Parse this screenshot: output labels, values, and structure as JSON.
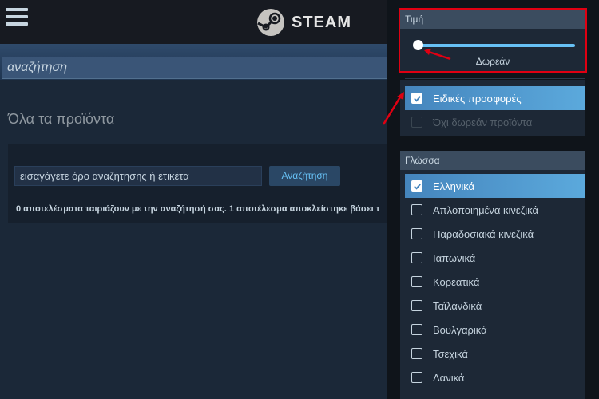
{
  "header": {
    "menu_icon": "hamburger-icon",
    "logo_icon": "steam-logo-icon",
    "logo_text": "STEAM"
  },
  "store": {
    "search_value": "αναζήτηση",
    "page_title": "Όλα τα προϊόντα",
    "term_placeholder": "εισαγάγετε όρο αναζήτησης ή ετικέτα",
    "search_button": "Αναζήτηση",
    "results_text": "0 αποτελέσματα ταιριάζουν με την αναζήτησή σας. 1 αποτέλεσμα αποκλείστηκε βάσει τ"
  },
  "filters": {
    "price": {
      "header": "Τιμή",
      "slider_value_fraction": 0,
      "value_label": "Δωρεάν",
      "options": [
        {
          "label": "Ειδικές προσφορές",
          "checked": true,
          "disabled": false
        },
        {
          "label": "Όχι δωρεάν προϊόντα",
          "checked": false,
          "disabled": true
        }
      ]
    },
    "language": {
      "header": "Γλώσσα",
      "options": [
        {
          "label": "Ελληνικά",
          "checked": true
        },
        {
          "label": "Απλοποιημένα κινεζικά",
          "checked": false
        },
        {
          "label": "Παραδοσιακά κινεζικά",
          "checked": false
        },
        {
          "label": "Ιαπωνικά",
          "checked": false
        },
        {
          "label": "Κορεατικά",
          "checked": false
        },
        {
          "label": "Ταϊλανδικά",
          "checked": false
        },
        {
          "label": "Βουλγαρικά",
          "checked": false
        },
        {
          "label": "Τσεχικά",
          "checked": false
        },
        {
          "label": "Δανικά",
          "checked": false
        }
      ]
    }
  },
  "colors": {
    "background": "#1b2838",
    "accent": "#67c1f5",
    "highlight": "#e00012"
  }
}
